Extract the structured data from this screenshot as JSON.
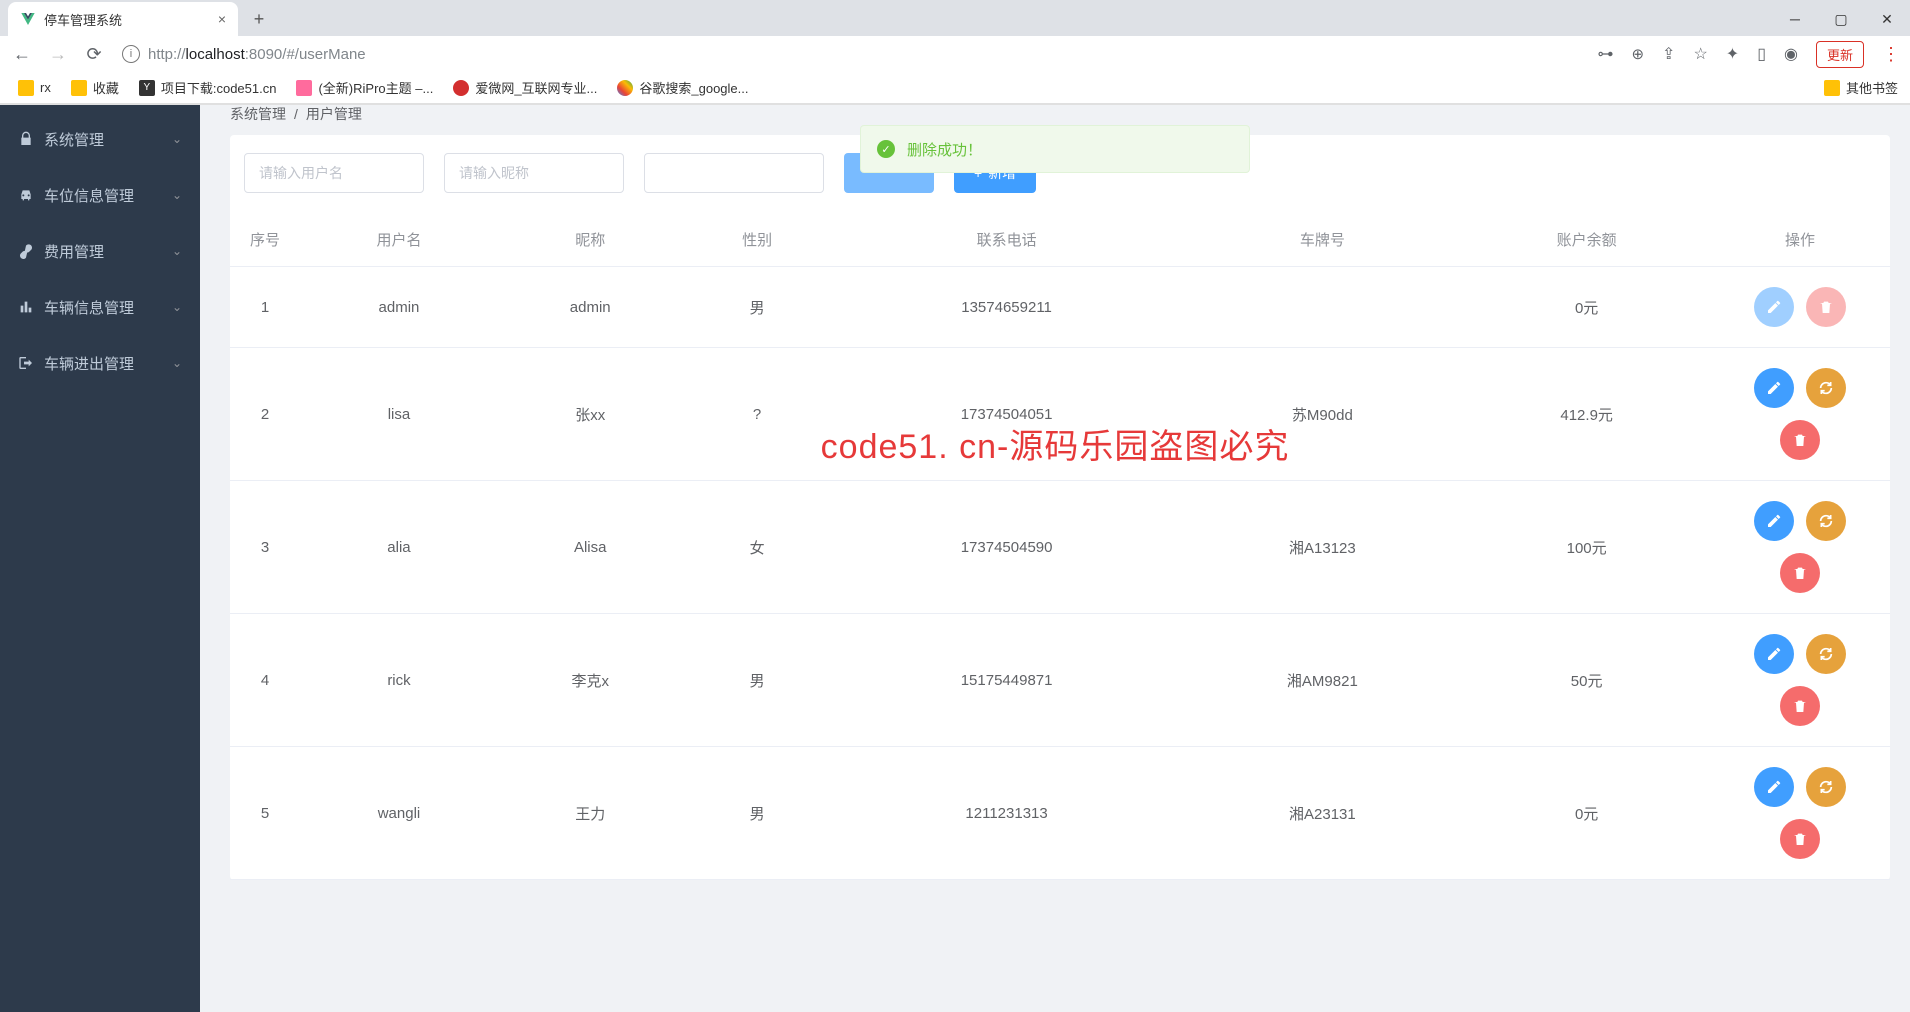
{
  "browser": {
    "tab_title": "停车管理系统",
    "url_host": "localhost",
    "url_prefix": "http://",
    "url_port_path": ":8090/#/userMane",
    "update_label": "更新"
  },
  "bookmarks": [
    {
      "label": "rx"
    },
    {
      "label": "收藏"
    },
    {
      "label": "项目下载:code51.cn"
    },
    {
      "label": "(全新)RiPro主题 –..."
    },
    {
      "label": "爱微网_互联网专业..."
    },
    {
      "label": "谷歌搜索_google..."
    }
  ],
  "bookmarks_right": "其他书签",
  "sidebar": {
    "items": [
      {
        "label": "系统管理"
      },
      {
        "label": "车位信息管理"
      },
      {
        "label": "费用管理"
      },
      {
        "label": "车辆信息管理"
      },
      {
        "label": "车辆进出管理"
      }
    ]
  },
  "breadcrumb": {
    "a": "系统管理",
    "sep": "/",
    "b": "用户管理"
  },
  "filters": {
    "username_ph": "请输入用户名",
    "nickname_ph": "请输入昵称",
    "phone_ph": "",
    "search_label": "",
    "add_label": "新增"
  },
  "toast": {
    "text": "删除成功！"
  },
  "table": {
    "headers": [
      "序号",
      "用户名",
      "昵称",
      "性别",
      "联系电话",
      "车牌号",
      "账户余额",
      "操作"
    ],
    "rows": [
      {
        "idx": "1",
        "user": "admin",
        "nick": "admin",
        "sex": "男",
        "phone": "13574659211",
        "plate": "",
        "balance": "0元",
        "ops": "simple"
      },
      {
        "idx": "2",
        "user": "lisa",
        "nick": "张xx",
        "sex": "?",
        "phone": "17374504051",
        "plate": "苏M90dd",
        "balance": "412.9元",
        "ops": "full"
      },
      {
        "idx": "3",
        "user": "alia",
        "nick": "Alisa",
        "sex": "女",
        "phone": "17374504590",
        "plate": "湘A13123",
        "balance": "100元",
        "ops": "full"
      },
      {
        "idx": "4",
        "user": "rick",
        "nick": "李克x",
        "sex": "男",
        "phone": "15175449871",
        "plate": "湘AM9821",
        "balance": "50元",
        "ops": "full"
      },
      {
        "idx": "5",
        "user": "wangli",
        "nick": "王力",
        "sex": "男",
        "phone": "1211231313",
        "plate": "湘A23131",
        "balance": "0元",
        "ops": "full"
      }
    ]
  },
  "watermark": "code51. cn-源码乐园盗图必究"
}
